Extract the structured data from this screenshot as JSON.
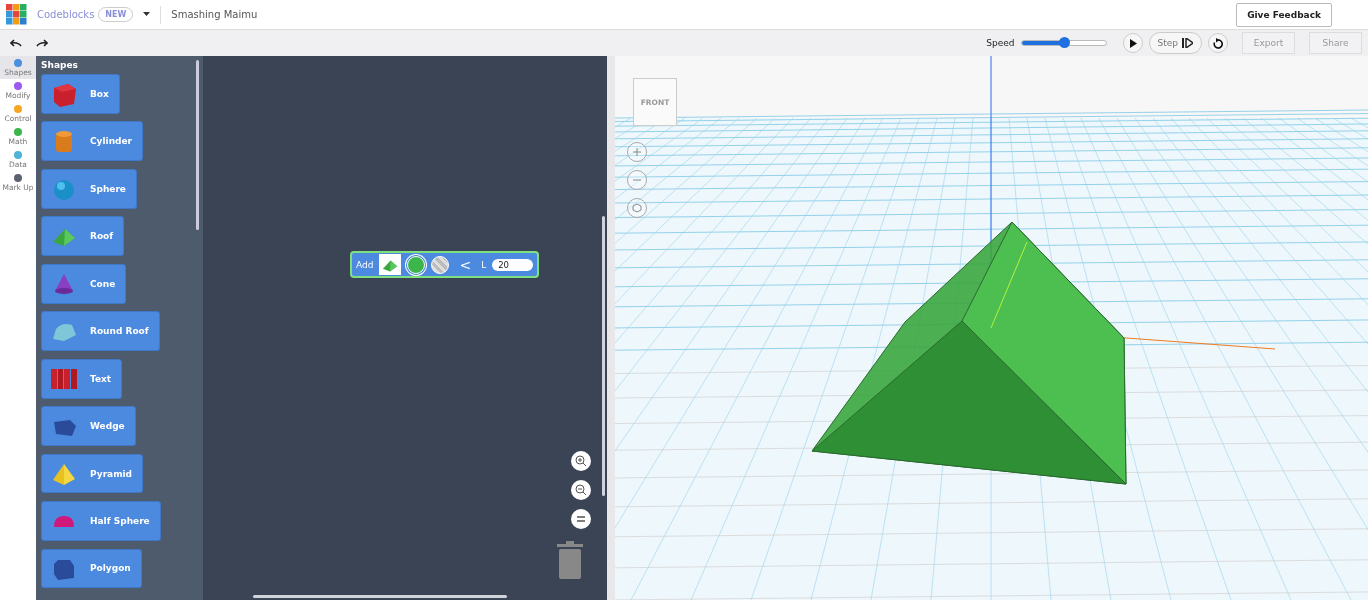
{
  "header": {
    "app_name": "Codeblocks",
    "badge": "NEW",
    "design_name": "Smashing Maimu",
    "feedback_button": "Give Feedback"
  },
  "toolbar": {
    "speed_label": "Speed",
    "speed": {
      "level": 0.5
    },
    "step_button": "Step",
    "actions": [
      {
        "label": "Export",
        "disabled": true
      },
      {
        "label": "Share",
        "disabled": true
      }
    ]
  },
  "categories": [
    {
      "label": "Shapes",
      "color": "#4a90e2",
      "selected": true
    },
    {
      "label": "Modify",
      "color": "#9b59f0",
      "selected": false
    },
    {
      "label": "Control",
      "color": "#f5a623",
      "selected": false
    },
    {
      "label": "Math",
      "color": "#3cb54a",
      "selected": false
    },
    {
      "label": "Data",
      "color": "#4fb3d9",
      "selected": false
    },
    {
      "label": "Mark Up",
      "color": "#5a6170",
      "selected": false
    }
  ],
  "flyout": {
    "title": "Shapes",
    "blocks": [
      {
        "kind": "box",
        "label": "Box"
      },
      {
        "kind": "cylinder",
        "label": "Cylinder"
      },
      {
        "kind": "sphere",
        "label": "Sphere"
      },
      {
        "kind": "roof",
        "label": "Roof"
      },
      {
        "kind": "cone",
        "label": "Cone"
      },
      {
        "kind": "roundroof",
        "label": "Round Roof"
      },
      {
        "kind": "text",
        "label": "Text"
      },
      {
        "kind": "wedge",
        "label": "Wedge"
      },
      {
        "kind": "pyramid",
        "label": "Pyramid"
      },
      {
        "kind": "halfsphere",
        "label": "Half Sphere"
      },
      {
        "kind": "polygon",
        "label": "Polygon"
      }
    ]
  },
  "workspace": {
    "block": {
      "label": "Add",
      "kind": "roof",
      "color": "#3cb54a",
      "solid_selected": true,
      "collapse": "<",
      "size_label": "L",
      "size": "20"
    }
  },
  "viewport": {
    "view_cube": "FRONT"
  }
}
